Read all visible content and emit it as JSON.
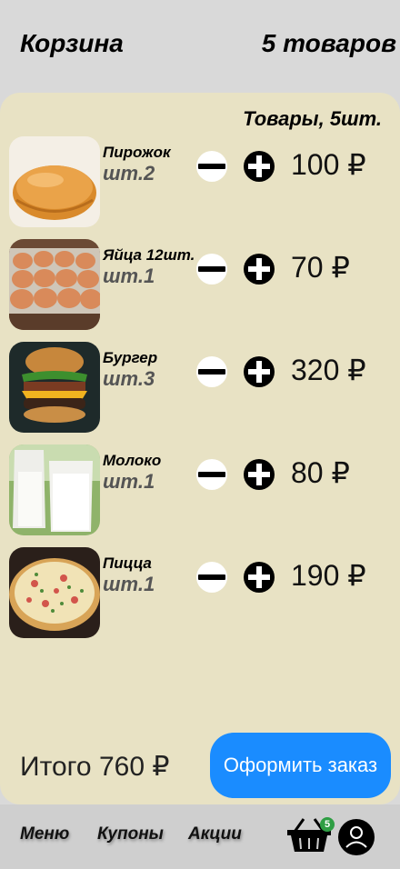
{
  "header": {
    "title": "Корзина",
    "count": "5 товаров"
  },
  "cart": {
    "summary": "Товары, 5шт.",
    "items": [
      {
        "name": "Пирожок",
        "qty": "шт.2",
        "price": "100 ₽",
        "icon": "pirozhok-image"
      },
      {
        "name": "Яйца 12шт.",
        "qty": "шт.1",
        "price": "70 ₽",
        "icon": "eggs-image"
      },
      {
        "name": "Бургер",
        "qty": "шт.3",
        "price": "320 ₽",
        "icon": "burger-image"
      },
      {
        "name": "Молоко",
        "qty": "шт.1",
        "price": "80 ₽",
        "icon": "milk-image"
      },
      {
        "name": "Пицца",
        "qty": "шт.1",
        "price": "190 ₽",
        "icon": "pizza-image"
      }
    ],
    "total": "Итого 760 ₽",
    "checkout_label": "Оформить заказ"
  },
  "footer": {
    "nav": [
      "Меню",
      "Купоны",
      "Акции"
    ],
    "cart_badge": "5"
  },
  "colors": {
    "panel": "#e8e2c4",
    "accent": "#1a8cff",
    "badge": "#2e9e43",
    "background": "#d9d9d9"
  }
}
